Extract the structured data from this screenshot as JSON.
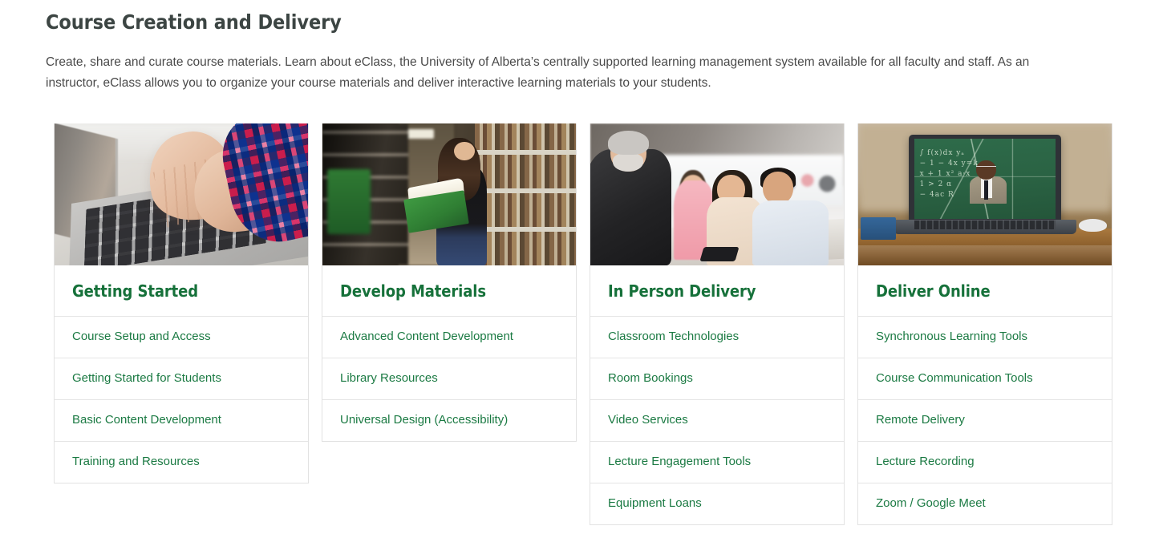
{
  "page": {
    "title": "Course Creation and Delivery",
    "intro": "Create, share and curate course materials. Learn about eClass, the University of Alberta’s centrally supported learning management system available for all faculty and staff. As an instructor, eClass allows you to organize your course materials and deliver interactive learning materials to your students.",
    "accent_green": "#16713a",
    "link_green": "#1b7a43",
    "title_color": "#3c4543",
    "border_color": "#e5e5e5",
    "background": "#ffffff"
  },
  "cards": [
    {
      "title": "Getting Started",
      "image_alt": "hands-typing-on-laptop-photo",
      "links": [
        "Course Setup and Access",
        "Getting Started for Students",
        "Basic Content Development",
        "Training and Resources"
      ]
    },
    {
      "title": "Develop Materials",
      "image_alt": "student-reading-book-in-library-photo",
      "links": [
        "Advanced Content Development",
        "Library Resources",
        "Universal Design (Accessibility)"
      ]
    },
    {
      "title": "In Person Delivery",
      "image_alt": "instructor-with-students-in-classroom-photo",
      "links": [
        "Classroom Technologies",
        "Room Bookings",
        "Video Services",
        "Lecture Engagement Tools",
        "Equipment Loans"
      ]
    },
    {
      "title": "Deliver Online",
      "image_alt": "laptop-showing-online-instructor-at-chalkboard-photo",
      "links": [
        "Synchronous Learning Tools",
        "Course Communication Tools",
        "Remote Delivery",
        "Lecture Recording",
        "Zoom / Google Meet"
      ]
    }
  ],
  "chalkboard_lines": [
    "∫ f(x)dx    yₐ",
    "− 1      − 4x      y=k",
    "x + 1      x²      a·x",
    "1 > 2         α",
    "− 4ac              R"
  ]
}
